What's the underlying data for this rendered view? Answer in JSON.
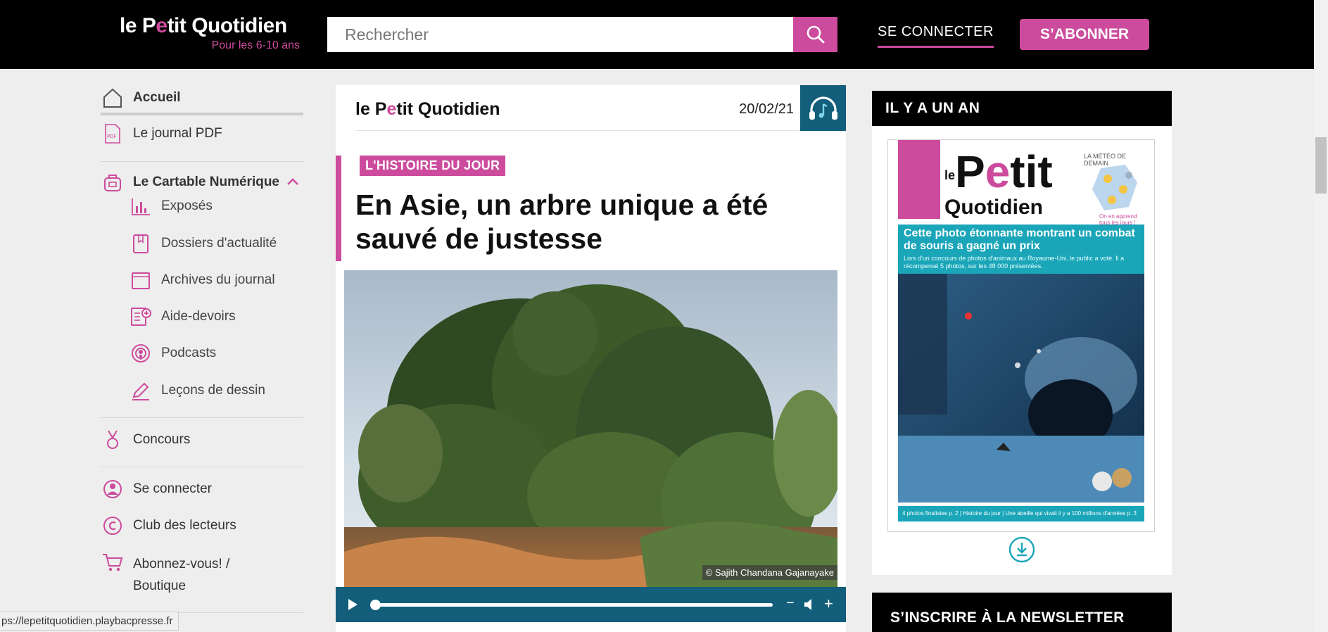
{
  "header": {
    "logo_prefix": "le P",
    "logo_e": "e",
    "logo_suffix": "tit Quotidien",
    "logo_tagline": "Pour les 6-10 ans",
    "search_placeholder": "Rechercher",
    "connect_label": "SE CONNECTER",
    "subscribe_label": "S’ABONNER"
  },
  "sidebar": {
    "items": [
      {
        "label": "Accueil",
        "icon": "home-icon"
      },
      {
        "label": "Le journal PDF",
        "icon": "pdf-icon"
      },
      {
        "label": "Le Cartable Numérique",
        "icon": "schoolbag-icon"
      },
      {
        "label": "Concours",
        "icon": "medal-icon"
      },
      {
        "label": "Se connecter",
        "icon": "user-icon"
      },
      {
        "label": "Club des lecteurs",
        "icon": "copyright-icon"
      },
      {
        "label": "Abonnez-vous! /",
        "label2": "Boutique",
        "icon": "cart-icon"
      }
    ],
    "sub_items": [
      {
        "label": "Exposés",
        "icon": "chart-icon"
      },
      {
        "label": "Dossiers d'actualité",
        "icon": "folder-icon"
      },
      {
        "label": "Archives du journal",
        "icon": "archive-icon"
      },
      {
        "label": "Aide-devoirs",
        "icon": "homework-icon"
      },
      {
        "label": "Podcasts",
        "icon": "podcast-icon"
      },
      {
        "label": "Leçons de dessin",
        "icon": "pencil-icon"
      }
    ]
  },
  "article": {
    "logo_prefix": "le P",
    "logo_e": "e",
    "logo_suffix": "tit Quotidien",
    "date": "20/02/21",
    "rubric": "L'HISTOIRE DU JOUR",
    "title": "En Asie, un arbre unique a été sauvé de justesse",
    "photo_credit": "© Sajith Chandana Gajanayake",
    "audio_progress": 0.0
  },
  "year_ago": {
    "heading": "IL Y A UN AN",
    "cover": {
      "logo_le": "le",
      "logo_petit_p": "P",
      "logo_petit_e": "e",
      "logo_petit_rest": "tit",
      "logo_quotidien": "Quotidien",
      "meteo": "LA MÉTÉO DE DEMAIN",
      "tagline": "On en apprend tous les jours !",
      "headline": "Cette photo étonnante montrant un combat de souris a gagné un prix",
      "subline": "Lors d'un concours de photos d'animaux au Royaume-Uni, le public a voté. Il a récompensé 5 photos, sur les 48 000 présentées.",
      "footer": "4 photos finalistes p. 2 | Histoire du jour | Une abeille qui vivait il y a 100 millions d'années p. 3"
    }
  },
  "newsletter": {
    "heading": "S’INSCRIRE À LA NEWSLETTER"
  },
  "status": {
    "url": "ps://lepetitquotidien.playbacpresse.fr"
  },
  "colors": {
    "brand_pink": "#cc4b9c",
    "audio_teal": "#135e7a",
    "cover_cyan": "#1aa5b8"
  }
}
